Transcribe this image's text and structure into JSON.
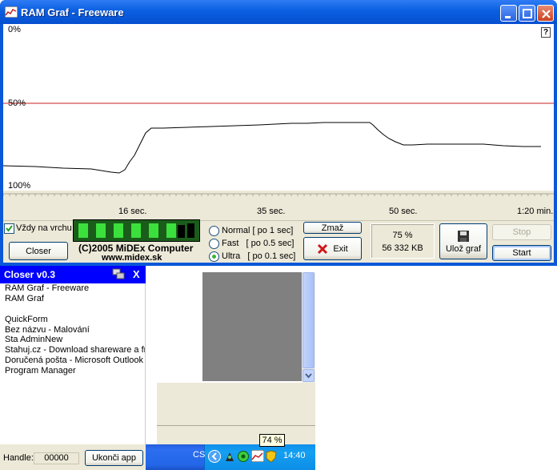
{
  "ram_window": {
    "title": "RAM Graf - Freeware",
    "help_button": "?",
    "graph": {
      "label_top": "0%",
      "label_mid": "50%",
      "label_bottom": "100%",
      "threshold_color": "#CC2222",
      "time_labels": [
        "16 sec.",
        "35 sec.",
        "50 sec.",
        "1:20 min."
      ]
    },
    "always_on_top_label": "Vždy na vrchu",
    "always_on_top_checked": true,
    "closer_button": "Closer",
    "copyright_line1": "(C)2005 MiDEx Computer",
    "copyright_line2": "www.midex.sk",
    "speed_options": [
      {
        "label": "Normal [ po 1 sec]",
        "selected": false
      },
      {
        "label": "Fast   [ po 0.5 sec]",
        "selected": false
      },
      {
        "label": "Ultra   [ po 0.1 sec]",
        "selected": true
      }
    ],
    "clear_button": "Zmaž",
    "exit_button": "Exit",
    "usage_percent": "75 %",
    "usage_kb": "56 332 KB",
    "save_button": "Ulož graf",
    "stop_button": "Stop",
    "start_button": "Start"
  },
  "closer_window": {
    "title": "Closer v0.3",
    "close_glyph": "X",
    "items": [
      "RAM Graf - Freeware",
      "RAM Graf",
      "",
      "QuickForm",
      "Bez názvu - Malování",
      "Sta AdminNew",
      "Stahuj.cz - Download shareware a freeware",
      "Doručená pošta - Microsoft Outlook",
      "Program Manager"
    ],
    "handle_label": "Handle:",
    "handle_value": "00000",
    "end_app_button": "Ukonči app"
  },
  "taskbar": {
    "language": "CS",
    "clock": "14:40",
    "tooltip": "74 %"
  }
}
